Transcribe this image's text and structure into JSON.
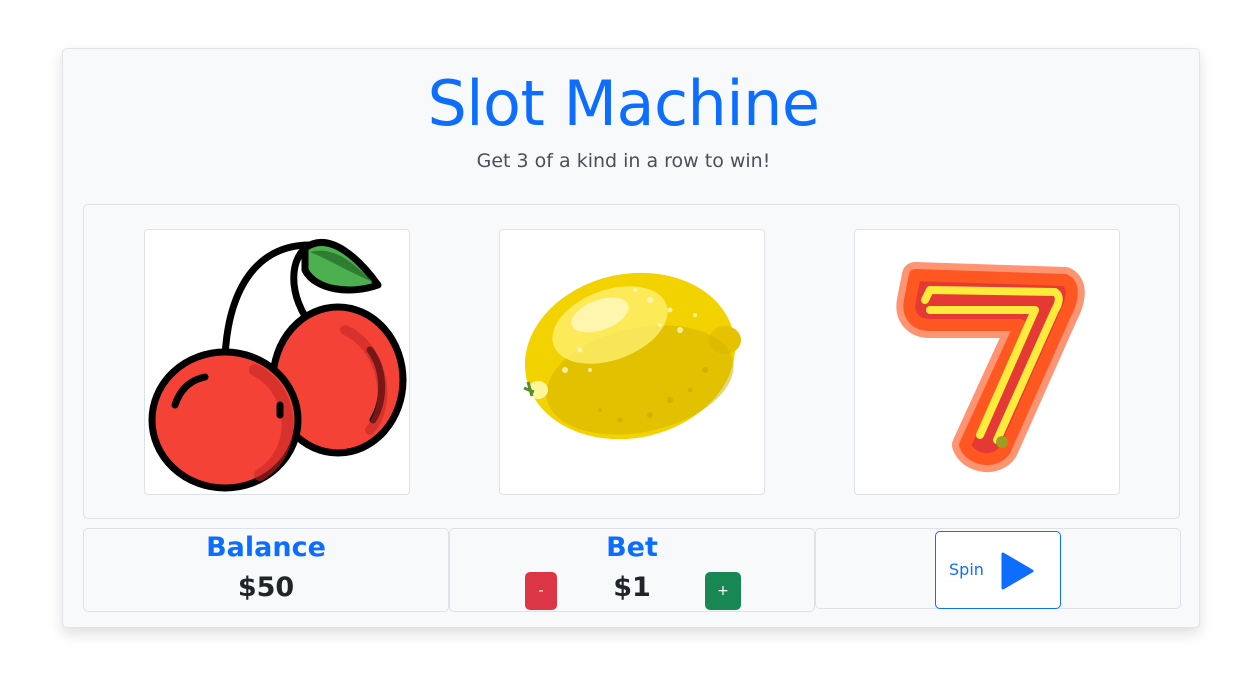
{
  "header": {
    "title": "Slot Machine",
    "subtitle": "Get 3 of a kind in a row to win!"
  },
  "reels": [
    {
      "symbol": "cherry-icon"
    },
    {
      "symbol": "lemon-icon"
    },
    {
      "symbol": "seven-icon"
    }
  ],
  "balance": {
    "label": "Balance",
    "value": "$50"
  },
  "bet": {
    "label": "Bet",
    "value": "$1",
    "decrease_label": "-",
    "increase_label": "+"
  },
  "spin": {
    "label": "Spin",
    "icon": "play-icon"
  },
  "colors": {
    "accent": "#0d6efd",
    "danger": "#dc3545",
    "success": "#198754",
    "card_bg": "#f8f9fa"
  }
}
